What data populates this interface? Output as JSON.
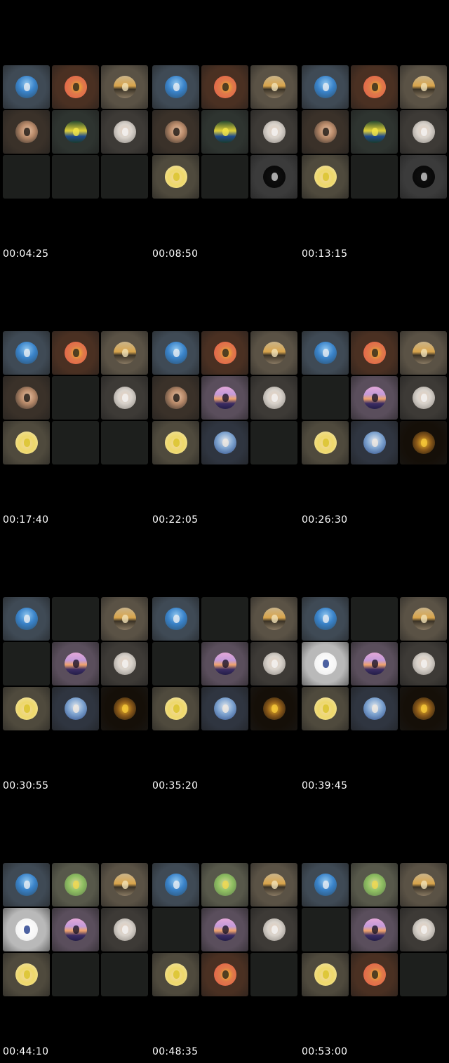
{
  "frames": [
    {
      "timestamp": "00:04:25",
      "tiles": [
        "sea-sailor",
        "yellow-player",
        "sunset-car",
        "selfie-man",
        "team-photo",
        "white-shirt-man",
        "empty",
        "empty",
        "empty"
      ]
    },
    {
      "timestamp": "00:08:50",
      "tiles": [
        "sea-sailor",
        "yellow-player",
        "sunset-car",
        "selfie-man",
        "team-photo",
        "white-shirt-man",
        "yellow-cap-man",
        "empty",
        "black-logo"
      ]
    },
    {
      "timestamp": "00:13:15",
      "tiles": [
        "sea-sailor",
        "yellow-player",
        "sunset-car",
        "selfie-man",
        "team-photo",
        "white-shirt-man",
        "yellow-cap-man",
        "empty",
        "black-logo"
      ]
    },
    {
      "timestamp": "00:17:40",
      "tiles": [
        "sea-sailor",
        "yellow-player",
        "sunset-car",
        "selfie-man",
        "empty",
        "white-shirt-man",
        "yellow-cap-man",
        "empty",
        "empty"
      ]
    },
    {
      "timestamp": "00:22:05",
      "tiles": [
        "sea-sailor",
        "yellow-player",
        "sunset-car",
        "selfie-man",
        "purple-sunset",
        "white-shirt-man",
        "yellow-cap-man",
        "boat-man",
        "empty"
      ]
    },
    {
      "timestamp": "00:26:30",
      "tiles": [
        "sea-sailor",
        "yellow-player",
        "sunset-car",
        "empty",
        "purple-sunset",
        "white-shirt-man",
        "yellow-cap-man",
        "boat-man",
        "dark-yellow"
      ]
    },
    {
      "timestamp": "00:30:55",
      "tiles": [
        "sea-sailor",
        "empty",
        "sunset-car",
        "empty",
        "purple-sunset",
        "white-shirt-man",
        "yellow-cap-man",
        "boat-man",
        "dark-yellow"
      ]
    },
    {
      "timestamp": "00:35:20",
      "tiles": [
        "sea-sailor",
        "empty",
        "sunset-car",
        "empty",
        "purple-sunset",
        "white-shirt-man",
        "yellow-cap-man",
        "boat-man",
        "dark-yellow"
      ]
    },
    {
      "timestamp": "00:39:45",
      "tiles": [
        "sea-sailor",
        "empty",
        "sunset-car",
        "flag-badge",
        "purple-sunset",
        "white-shirt-man",
        "yellow-cap-man",
        "boat-man",
        "dark-yellow"
      ]
    },
    {
      "timestamp": "00:44:10",
      "tiles": [
        "sea-sailor",
        "field-player",
        "sunset-car",
        "flag-badge",
        "purple-sunset",
        "white-shirt-man",
        "yellow-cap-man",
        "empty",
        "empty"
      ]
    },
    {
      "timestamp": "00:48:35",
      "tiles": [
        "sea-sailor",
        "field-player",
        "sunset-car",
        "empty",
        "purple-sunset",
        "white-shirt-man",
        "yellow-cap-man",
        "yellow-player",
        "empty"
      ]
    },
    {
      "timestamp": "00:53:00",
      "tiles": [
        "sea-sailor",
        "field-player",
        "sunset-car",
        "empty",
        "purple-sunset",
        "white-shirt-man",
        "yellow-cap-man",
        "yellow-player",
        "empty"
      ]
    }
  ],
  "participants": {
    "sea-sailor": {
      "icon": "sailor-at-sea-avatar-icon",
      "tile_bg": "#3f4a55",
      "fill": "radial-gradient(circle at 50% 35%, #8ec6f0 0%, #3a83c9 45%, #2b4f6e 100%)",
      "accent": "#e8eef2"
    },
    "yellow-player": {
      "icon": "yellow-jersey-player-icon",
      "tile_bg": "#4a3022",
      "fill": "radial-gradient(circle at 55% 50%, #f0c02a 0%, #e07a4a 40%, #e35b4b 100%)",
      "accent": "#2a241b"
    },
    "sunset-car": {
      "icon": "car-at-sunset-icon",
      "tile_bg": "#5a5245",
      "fill": "linear-gradient(180deg, #c9b48a 0%, #d9a54c 45%, #3b3326 60%, #8a7a63 100%)",
      "accent": "#f3e2b6"
    },
    "selfie-man": {
      "icon": "selfie-man-avatar-icon",
      "tile_bg": "#3a3129",
      "fill": "radial-gradient(circle at 55% 45%, #e9c3a4 0%, #b88a6a 40%, #2f2a26 100%)",
      "accent": "#1a1512"
    },
    "team-photo": {
      "icon": "team-photo-avatar-icon",
      "tile_bg": "#2e3430",
      "fill": "linear-gradient(180deg, #20452f 0%, #e2d23a 45%, #1f4a8a 70%, #1a3a2a 100%)",
      "accent": "#f4e64a"
    },
    "white-shirt-man": {
      "icon": "white-shirt-man-avatar-icon",
      "tile_bg": "#3d3a36",
      "fill": "radial-gradient(circle at 50% 45%, #e8d2c0 0%, #d9d3cc 40%, #8b8680 100%)",
      "accent": "#f4f4f4"
    },
    "yellow-cap-man": {
      "icon": "yellow-cap-man-avatar-icon",
      "tile_bg": "#4f4a3d",
      "fill": "radial-gradient(circle at 50% 55%, #f1d8a0 0%, #eed86a 45%, #efe2b0 100%)",
      "accent": "#d9c326"
    },
    "black-logo": {
      "icon": "black-logo-avatar-icon",
      "tile_bg": "#3b3b3b",
      "fill": "radial-gradient(circle at 50% 50%, #111 0%, #050505 100%)",
      "accent": "#cfcfcf"
    },
    "purple-sunset": {
      "icon": "purple-sunset-avatar-icon",
      "tile_bg": "#5a4e5c",
      "fill": "linear-gradient(180deg, #e3a7d7 0%, #c39ad9 35%, #f0a36b 55%, #3b2d63 75%, #231d48 100%)",
      "accent": "#1a1428"
    },
    "boat-man": {
      "icon": "man-on-boat-avatar-icon",
      "tile_bg": "#2f3540",
      "fill": "radial-gradient(circle at 50% 40%, #dfe6ee 0%, #7ea3cf 45%, #2e4c86 100%)",
      "accent": "#f0e8e0"
    },
    "dark-yellow": {
      "icon": "dark-yellow-figure-avatar-icon",
      "tile_bg": "#150f08",
      "fill": "radial-gradient(circle at 50% 50%, #f2bb2b 0%, #8b5a1a 45%, #1a120a 100%)",
      "accent": "#f5c83a"
    },
    "flag-badge": {
      "icon": "flag-badge-avatar-icon",
      "tile_bg": "#b9b9b9",
      "fill": "radial-gradient(circle at 50% 45%, #ffffff 0%, #f5f5f5 60%, #e4e4e4 100%)",
      "accent": "#1f3a8a"
    },
    "field-player": {
      "icon": "field-player-avatar-icon",
      "tile_bg": "#57584a",
      "fill": "radial-gradient(circle at 50% 45%, #d8d69a 0%, #8fbf62 45%, #5e7a4c 100%)",
      "accent": "#f0d84c"
    }
  }
}
